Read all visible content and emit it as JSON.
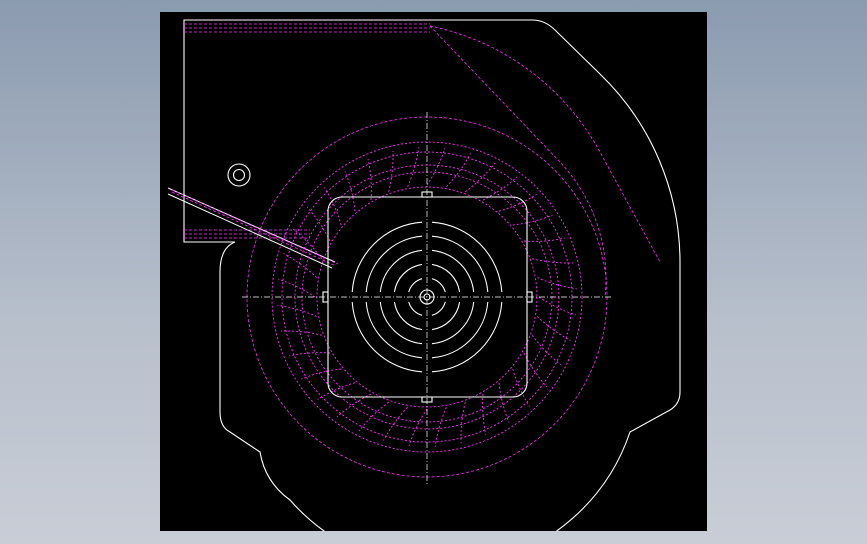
{
  "viewport": {
    "background_color": "#000000",
    "outer_background_colors": [
      "#8b9bb0",
      "#c9cdd6"
    ]
  },
  "drawing": {
    "line_colors": {
      "outline": "#ffffff",
      "hidden": "#ff33ff",
      "centerline": "#ffffff"
    },
    "impeller_blade_count": 36,
    "vent_ring_count": 5
  }
}
